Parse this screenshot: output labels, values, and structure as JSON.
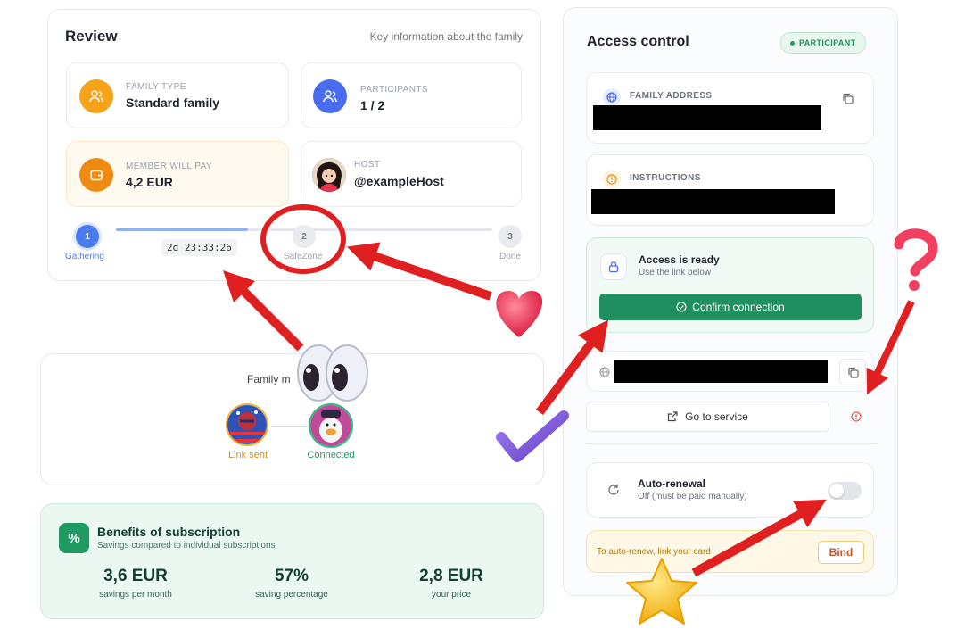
{
  "review": {
    "title": "Review",
    "subtitle": "Key information about the family",
    "family_type": {
      "label": "FAMILY TYPE",
      "value": "Standard family"
    },
    "participants": {
      "label": "PARTICIPANTS",
      "value": "1 / 2"
    },
    "member_pay": {
      "label": "MEMBER WILL PAY",
      "value": "4,2 EUR"
    },
    "host": {
      "label": "HOST",
      "value": "@exampleHost"
    },
    "steps": [
      {
        "num": "1",
        "label": "Gathering"
      },
      {
        "num": "2",
        "label": "SafeZone"
      },
      {
        "num": "3",
        "label": "Done"
      }
    ],
    "timer": "2d 23:33:26",
    "progress": 0.35
  },
  "members": {
    "title": "Family m",
    "items": [
      {
        "status": "Link sent"
      },
      {
        "status": "Connected"
      }
    ]
  },
  "benefits": {
    "title": "Benefits of subscription",
    "subtitle": "Savings compared to individual subscriptions",
    "stats": [
      {
        "value": "3,6 EUR",
        "label": "savings per month"
      },
      {
        "value": "57%",
        "label": "saving percentage"
      },
      {
        "value": "2,8 EUR",
        "label": "your price"
      }
    ]
  },
  "access": {
    "title": "Access control",
    "badge": "PARTICIPANT",
    "family_address_label": "FAMILY ADDRESS",
    "instructions_label": "INSTRUCTIONS",
    "ready_title": "Access is ready",
    "ready_sub": "Use the link below",
    "confirm_label": "Confirm connection",
    "go_label": "Go to service",
    "autorenew_title": "Auto-renewal",
    "autorenew_sub": "Off (must be paid manually)",
    "autorenew_on": false,
    "card_text": "To auto-renew, link your card",
    "bind_label": "Bind"
  },
  "colors": {
    "accent_blue": "#4a7cf0",
    "green": "#1f8f5f",
    "orange": "#f39a1c",
    "red_annotation": "#e02020"
  }
}
